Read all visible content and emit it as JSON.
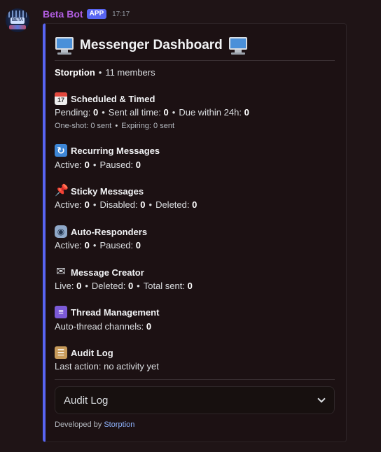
{
  "message": {
    "author": "Beta Bot",
    "badge": "APP",
    "time": "17:17",
    "avatar_label": "BETA"
  },
  "embed": {
    "accent_color": "#5865f2",
    "title": "Messenger Dashboard",
    "title_icon": "desktop-computer-icon",
    "server": {
      "name": "Storption",
      "members": "11 members"
    },
    "sections": {
      "scheduled": {
        "icon": "calendar-icon",
        "calendar_day": "17",
        "title": "Scheduled & Timed",
        "pending_label": "Pending:",
        "pending": "0",
        "sent_label": "Sent all time:",
        "sent": "0",
        "due_label": "Due within 24h:",
        "due": "0",
        "oneshot": "One-shot: 0 sent",
        "expiring": "Expiring: 0 sent"
      },
      "recurring": {
        "icon": "repeat-icon",
        "title": "Recurring Messages",
        "active_label": "Active:",
        "active": "0",
        "paused_label": "Paused:",
        "paused": "0"
      },
      "sticky": {
        "icon": "pushpin-icon",
        "title": "Sticky Messages",
        "active_label": "Active:",
        "active": "0",
        "disabled_label": "Disabled:",
        "disabled": "0",
        "deleted_label": "Deleted:",
        "deleted": "0"
      },
      "autoresponders": {
        "icon": "robot-icon",
        "title": "Auto-Responders",
        "active_label": "Active:",
        "active": "0",
        "paused_label": "Paused:",
        "paused": "0"
      },
      "creator": {
        "icon": "envelope-icon",
        "title": "Message Creator",
        "live_label": "Live:",
        "live": "0",
        "deleted_label": "Deleted:",
        "deleted": "0",
        "total_label": "Total sent:",
        "total": "0"
      },
      "threads": {
        "icon": "thread-spool-icon",
        "title": "Thread Management",
        "channels_label": "Auto-thread channels:",
        "channels": "0"
      },
      "audit": {
        "icon": "clipboard-icon",
        "title": "Audit Log",
        "last_action": "Last action: no activity yet"
      }
    },
    "select": {
      "value": "Audit Log"
    },
    "footer": {
      "prefix": "Developed by",
      "link": "Storption"
    }
  }
}
